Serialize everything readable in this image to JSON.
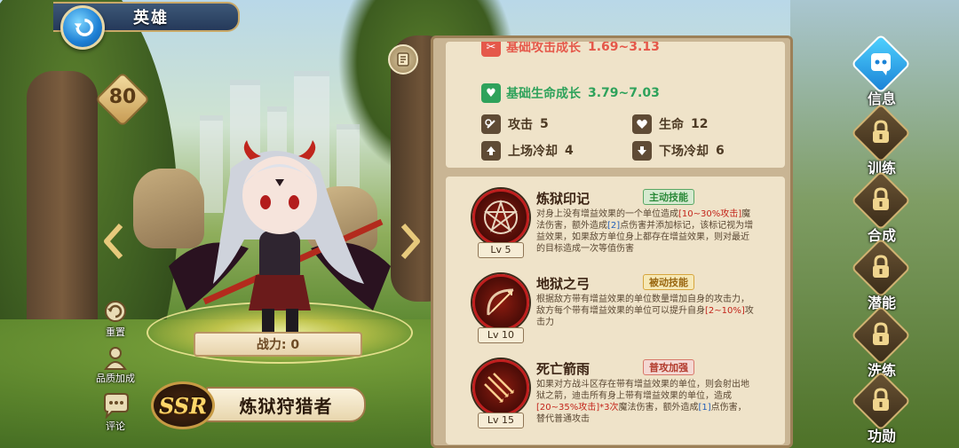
{
  "title": "英雄",
  "hero": {
    "level": "80",
    "power_label": "战力: 0",
    "rarity": "SSR",
    "name": "炼狱狩猎者"
  },
  "left_actions": [
    {
      "label": "重置",
      "icon": "reset-icon"
    },
    {
      "label": "品质加成",
      "icon": "quality-icon"
    },
    {
      "label": "评论",
      "icon": "comment-icon"
    }
  ],
  "stats": {
    "attack_growth": {
      "label": "基础攻击成长",
      "value": "1.69~3.13"
    },
    "hp_growth": {
      "label": "基础生命成长",
      "value": "3.79~7.03"
    },
    "attack": {
      "label": "攻击",
      "value": "5"
    },
    "hp": {
      "label": "生命",
      "value": "12"
    },
    "enter_cd": {
      "label": "上场冷却",
      "value": "4"
    },
    "exit_cd": {
      "label": "下场冷却",
      "value": "6"
    }
  },
  "skills": [
    {
      "name": "炼狱印记",
      "tag": "主动技能",
      "level": "Lv 5",
      "desc": [
        {
          "t": "对身上没有增益效果的一个单位造成",
          "c": ""
        },
        {
          "t": "[10~30%攻击]",
          "c": "r"
        },
        {
          "t": "魔法伤害，额外造成",
          "c": ""
        },
        {
          "t": "[2]",
          "c": "b"
        },
        {
          "t": "点伤害并添加标记，该标记视为增益效果，如果敌方单位身上都存在增益效果，则对最近的目标造成一次等值伤害",
          "c": ""
        }
      ]
    },
    {
      "name": "地狱之弓",
      "tag": "被动技能",
      "level": "Lv 10",
      "desc": [
        {
          "t": "根据敌方带有增益效果的单位数量增加自身的攻击力，敌方每个带有增益效果的单位可以提升自身",
          "c": ""
        },
        {
          "t": "[2~10%]",
          "c": "r"
        },
        {
          "t": "攻击力",
          "c": ""
        }
      ]
    },
    {
      "name": "死亡箭雨",
      "tag": "普攻加强",
      "level": "Lv 15",
      "desc": [
        {
          "t": "如果对方战斗区存在带有增益效果的单位，则会射出地狱之箭，迪击所有身上带有增益效果的单位，造成",
          "c": ""
        },
        {
          "t": "[20~35%攻击]*3次",
          "c": "r"
        },
        {
          "t": "魔法伤害，额外造成",
          "c": ""
        },
        {
          "t": "[1]",
          "c": "b"
        },
        {
          "t": "点伤害，替代普通攻击",
          "c": ""
        }
      ]
    }
  ],
  "nav": [
    {
      "label": "信息",
      "active": true
    },
    {
      "label": "训练",
      "active": false
    },
    {
      "label": "合成",
      "active": false
    },
    {
      "label": "潜能",
      "active": false
    },
    {
      "label": "洗练",
      "active": false
    },
    {
      "label": "功勋",
      "active": false
    }
  ]
}
